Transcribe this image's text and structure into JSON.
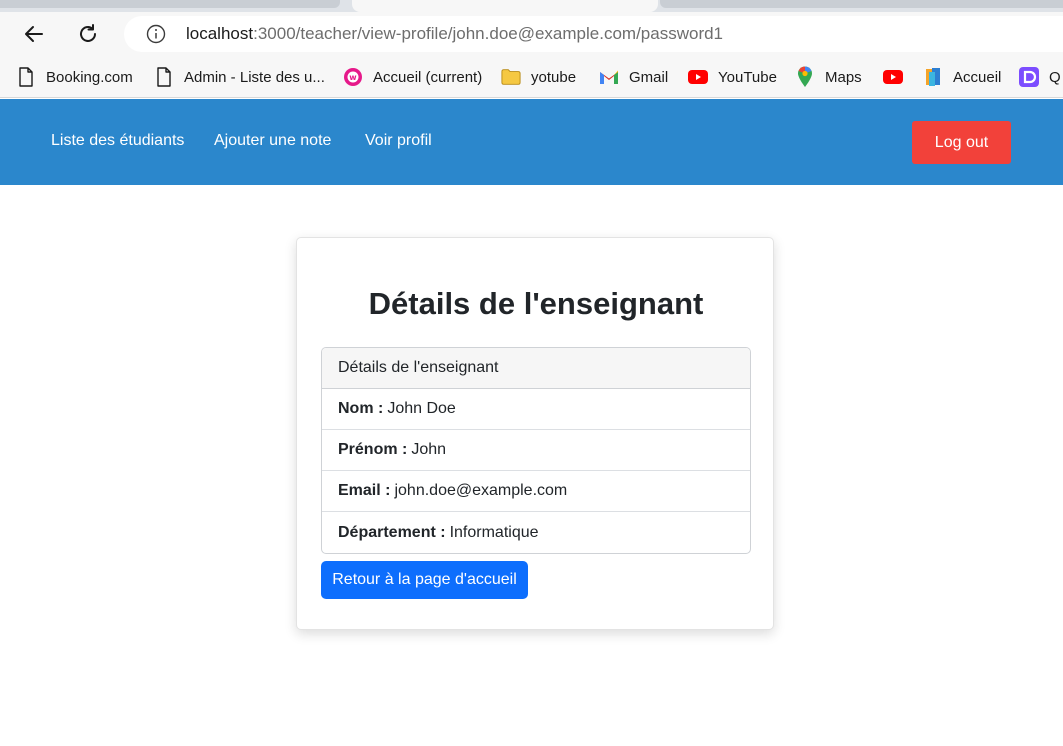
{
  "browser": {
    "url_host": "localhost",
    "url_path": ":3000/teacher/view-profile/john.doe@example.com/password1",
    "bookmarks": [
      {
        "label": "Booking.com",
        "icon": "page-icon"
      },
      {
        "label": "Admin - Liste des u...",
        "icon": "page-icon"
      },
      {
        "label": "Accueil (current)",
        "icon": "wamp-icon"
      },
      {
        "label": "yotube",
        "icon": "folder-icon"
      },
      {
        "label": "Gmail",
        "icon": "gmail-icon"
      },
      {
        "label": "YouTube",
        "icon": "youtube-icon"
      },
      {
        "label": "Maps",
        "icon": "maps-icon"
      },
      {
        "label": "",
        "icon": "youtube-icon"
      },
      {
        "label": "Accueil",
        "icon": "book-icon"
      },
      {
        "label": "Q",
        "icon": "app-icon"
      }
    ]
  },
  "navbar": {
    "links": [
      "Liste des étudiants",
      "Ajouter une note",
      "Voir profil"
    ],
    "logout_label": "Log out"
  },
  "card": {
    "title": "Détails de l'enseignant",
    "list_header": "Détails de l'enseignant",
    "fields": [
      {
        "label": "Nom :",
        "value": "John Doe"
      },
      {
        "label": "Prénom :",
        "value": "John"
      },
      {
        "label": "Email :",
        "value": "john.doe@example.com"
      },
      {
        "label": "Département :",
        "value": "Informatique"
      }
    ],
    "home_button": "Retour à la page d'accueil"
  },
  "colors": {
    "navbar": "#2b87cc",
    "logout": "#f2413a",
    "primary_button": "#0d6efd"
  }
}
